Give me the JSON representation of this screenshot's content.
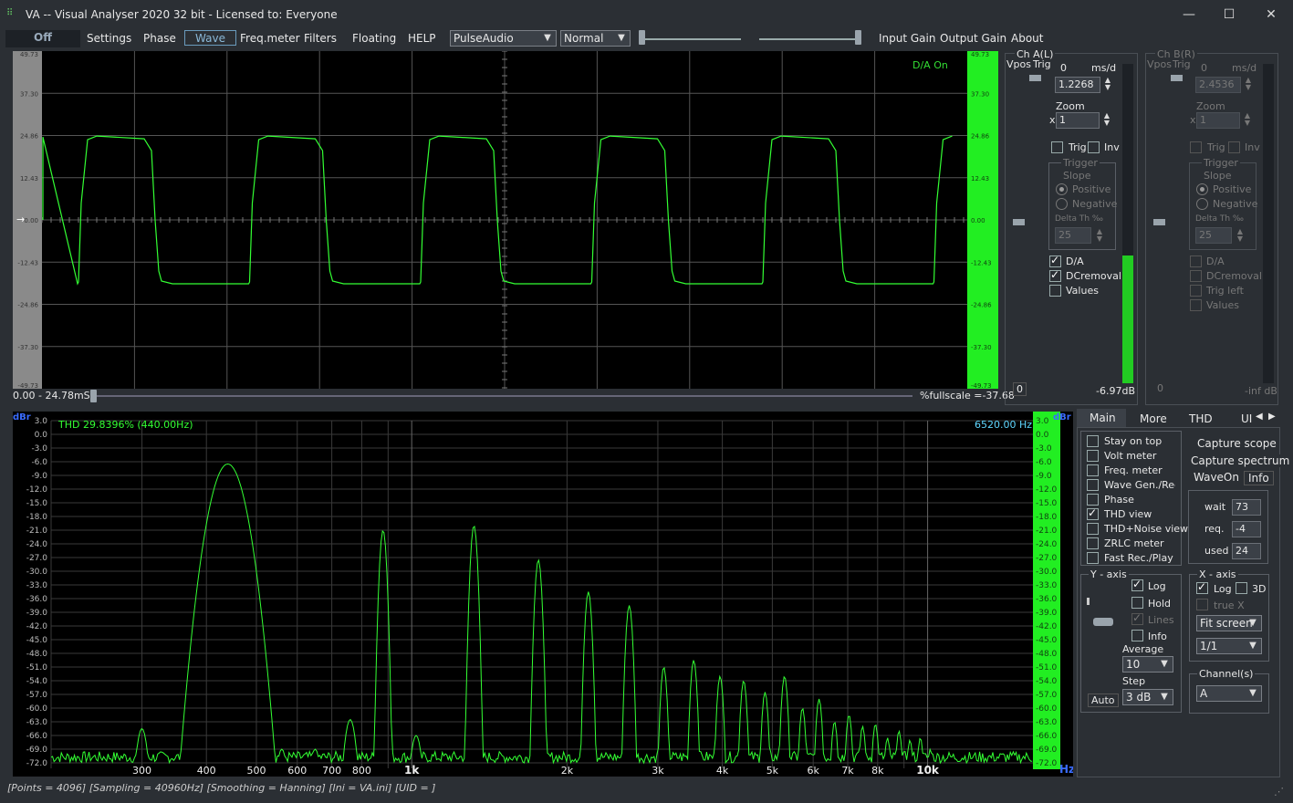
{
  "window": {
    "title": "VA -- Visual Analyser 2020 32 bit - Licensed to: Everyone",
    "min_label": "—",
    "max_label": "☐",
    "close_label": "✕"
  },
  "menu": {
    "off": "Off",
    "settings": "Settings",
    "phase": "Phase",
    "wave": "Wave",
    "freqmeter": "Freq.meter",
    "filters": "Filters",
    "floating": "Floating",
    "help": "HELP",
    "audio_device": "PulseAudio",
    "mode": "Normal",
    "input_gain": "Input Gain",
    "output_gain": "Output Gain",
    "about": "About"
  },
  "scope": {
    "da_on": "D/A On",
    "y_ticks": [
      "49.73",
      "37.30",
      "24.86",
      "12.43",
      "0.00",
      "-12.43",
      "-24.86",
      "-37.30",
      "-49.73"
    ],
    "range": "0.00 - 24.78mS",
    "fullscale": "%fullscale =-37.68",
    "wave_color": "#33ff33"
  },
  "chA": {
    "title": "Ch A(L)",
    "vpos": "Vpos",
    "trig": "Trig",
    "offset": "0",
    "unit": "ms/d",
    "msd": "1.2268",
    "zoom_label": "Zoom",
    "zoom_x": "x",
    "zoom": "1",
    "trig_cb": "Trig",
    "inv_cb": "Inv",
    "trigger": "Trigger",
    "slope": "Slope",
    "positive": "Positive",
    "negative": "Negative",
    "delta": "Delta Th ‰",
    "delta_val": "25",
    "da": "D/A",
    "dcremoval": "DCremoval",
    "values": "Values",
    "meter_zero": "0",
    "level": "-6.97dB",
    "meter_fill": 0.4
  },
  "chB": {
    "title": "Ch B(R)",
    "vpos": "Vpos",
    "trig": "Trig",
    "offset": "0",
    "unit": "ms/d",
    "msd": "2.4536",
    "zoom_label": "Zoom",
    "zoom_x": "x",
    "zoom": "1",
    "trig_cb": "Trig",
    "inv_cb": "Inv",
    "trigger": "Trigger",
    "slope": "Slope",
    "positive": "Positive",
    "negative": "Negative",
    "delta": "Delta Th ‰",
    "delta_val": "25",
    "da": "D/A",
    "dcremoval": "DCremoval",
    "trigleft": "Trig left",
    "values": "Values",
    "meter_zero": "0",
    "level": "-inf dB"
  },
  "spectrum": {
    "unit_left": "dBr",
    "unit_right": "dBr",
    "thd": "THD  29.8396% (440.00Hz)",
    "freq": "6520.00 Hz",
    "hz": "Hz",
    "y_ticks": [
      "3.0",
      "0.0",
      "-3.0",
      "-6.0",
      "-9.0",
      "-12.0",
      "-15.0",
      "-18.0",
      "-21.0",
      "-24.0",
      "-27.0",
      "-30.0",
      "-33.0",
      "-36.0",
      "-39.0",
      "-42.0",
      "-45.0",
      "-48.0",
      "-51.0",
      "-54.0",
      "-57.0",
      "-60.0",
      "-63.0",
      "-66.0",
      "-69.0",
      "-72.0"
    ],
    "x_ticks": [
      "300",
      "400",
      "500",
      "600",
      "700",
      "800",
      "1k",
      "2k",
      "3k",
      "4k",
      "5k",
      "6k",
      "7k",
      "8k",
      "10k"
    ],
    "x_tick_freqs": [
      300,
      400,
      500,
      600,
      700,
      800,
      1000,
      2000,
      3000,
      4000,
      5000,
      6000,
      7000,
      8000,
      10000
    ]
  },
  "chart_data": {
    "type": "line",
    "xlabel": "Hz",
    "ylabel": "dBr",
    "xlim": [
      200,
      16000
    ],
    "ylim": [
      -72,
      3
    ],
    "x_scale": "log",
    "grid": true,
    "peaks_hz": [
      440,
      880,
      1320,
      1760,
      2200,
      2640,
      3080,
      3520,
      3960,
      4400,
      4840,
      5280,
      5720,
      6160,
      6600,
      7040,
      7480,
      7920,
      8360,
      8800,
      9240,
      9680,
      10120
    ],
    "peaks_db": [
      -6.5,
      -21.0,
      -20.0,
      -27.5,
      -34.5,
      -37.5,
      -51.0,
      -49.5,
      -53.0,
      -54.0,
      -56.5,
      -53.0,
      -60.0,
      -58.0,
      -63.0,
      -61.5,
      -64.0,
      -63.5,
      -66.5,
      -65.0,
      -67.0,
      -66.5,
      -69.0
    ]
  },
  "tabs": {
    "main": "Main",
    "more": "More",
    "thd": "THD",
    "ui": "UI"
  },
  "options": {
    "stay_on_top": "Stay on top",
    "volt_meter": "Volt meter",
    "freq_meter": "Freq. meter",
    "wave_gen": "Wave Gen./Rec",
    "phase": "Phase",
    "thd_view": "THD view",
    "thd_noise": "THD+Noise view",
    "zrlc": "ZRLC meter",
    "fast_rec": "Fast Rec./Play"
  },
  "capture": {
    "scope": "Capture scope",
    "spectrum": "Capture spectrum",
    "waveon": "WaveOn",
    "info": "Info",
    "wait_l": "wait",
    "wait_v": "73",
    "req_l": "req.",
    "req_v": "-4",
    "used_l": "used",
    "used_v": "24"
  },
  "yaxis": {
    "title": "Y - axis",
    "log": "Log",
    "hold": "Hold",
    "lines": "Lines",
    "info": "Info",
    "average": "Average",
    "avg_val": "10",
    "step": "Step",
    "step_val": "3 dB",
    "auto": "Auto"
  },
  "xaxis": {
    "title": "X - axis",
    "log": "Log",
    "three_d": "3D",
    "truex": "true X",
    "fit": "Fit screen",
    "ratio": "1/1"
  },
  "channels": {
    "title": "Channel(s)",
    "val": "A"
  },
  "status": "[Points = 4096]  [Sampling = 40960Hz]  [Smoothing = Hanning]  [Ini = VA.ini]  [UID = ]"
}
